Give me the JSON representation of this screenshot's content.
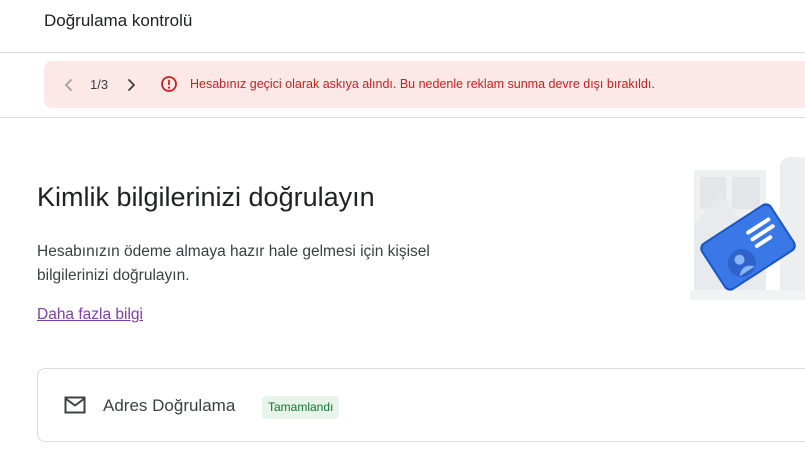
{
  "header": {
    "title": "Doğrulama kontrolü"
  },
  "alert": {
    "counter": "1/3",
    "message": "Hesabınız geçici olarak askıya alındı. Bu nedenle reklam sunma devre dışı bırakıldı.",
    "color": "#c5221f",
    "background": "#fce8e6"
  },
  "main": {
    "heading": "Kimlik bilgilerinizi doğrulayın",
    "description": "Hesabınızın ödeme almaya hazır hale gelmesi için kişisel bilgilerinizi doğrulayın.",
    "more_link": "Daha fazla bilgi"
  },
  "steps": [
    {
      "icon": "mail-icon",
      "title": "Adres Doğrulama",
      "status": "Tamamlandı"
    }
  ]
}
